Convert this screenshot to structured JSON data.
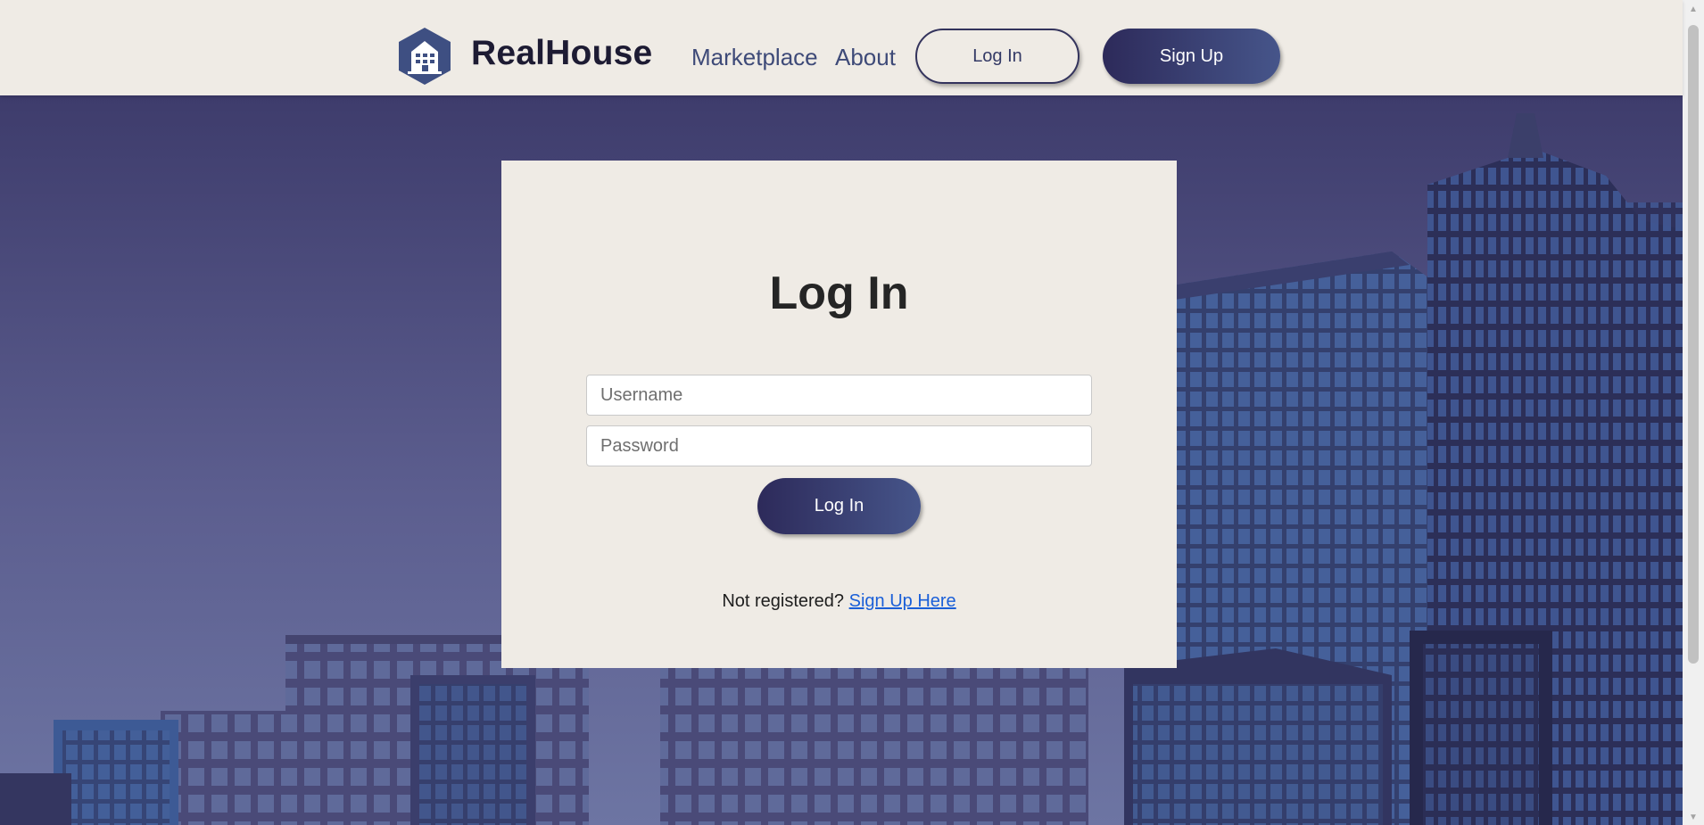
{
  "brand": {
    "name": "RealHouse",
    "logo_icon": "building-icon",
    "logo_color": "#3e4f82"
  },
  "nav": {
    "marketplace": "Marketplace",
    "about": "About",
    "login": "Log In",
    "signup": "Sign Up"
  },
  "login_form": {
    "title": "Log In",
    "username_placeholder": "Username",
    "username_value": "",
    "password_placeholder": "Password",
    "password_value": "",
    "submit_label": "Log In",
    "register_prompt": "Not registered?",
    "register_link": "Sign Up Here"
  },
  "colors": {
    "header_bg": "#efebe5",
    "accent_dark": "#2d2a5a",
    "accent_light": "#46558a",
    "link": "#1a5fd8"
  }
}
